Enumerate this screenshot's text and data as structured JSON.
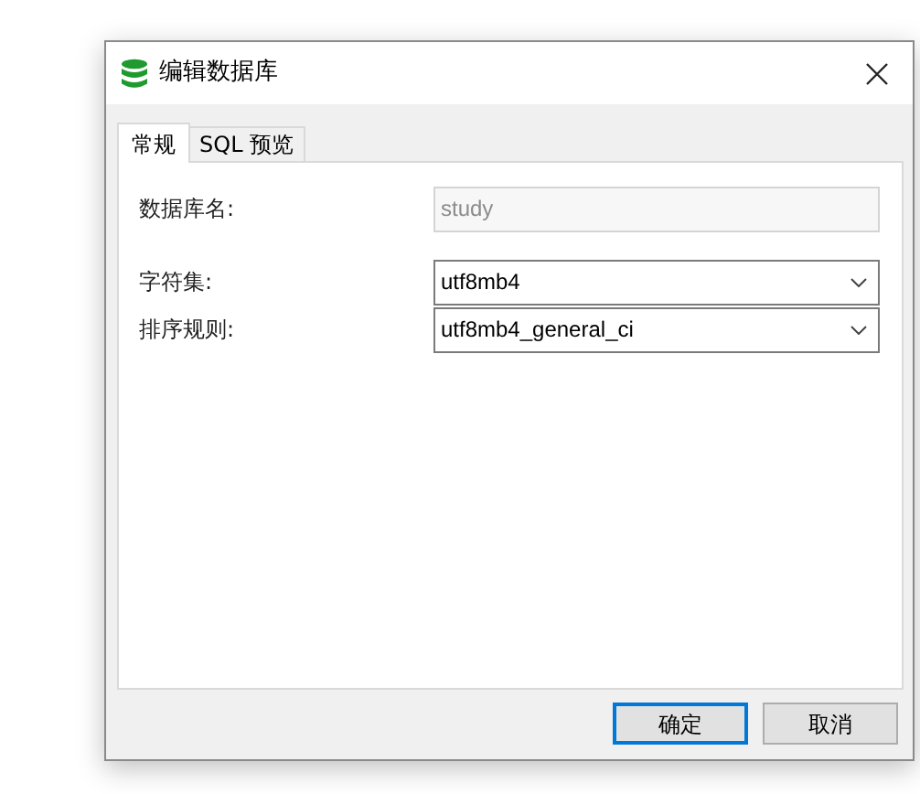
{
  "window": {
    "title": "编辑数据库"
  },
  "tabs": [
    {
      "label": "常规",
      "selected": true
    },
    {
      "label": "SQL 预览",
      "selected": false
    }
  ],
  "fields": [
    {
      "kind": "text",
      "label": "数据库名:",
      "value": "study",
      "disabled": true
    },
    {
      "kind": "select",
      "label": "字符集:",
      "value": "utf8mb4",
      "disabled": false
    },
    {
      "kind": "select",
      "label": "排序规则:",
      "value": "utf8mb4_general_ci",
      "disabled": false
    }
  ],
  "buttons": [
    {
      "label": "确定",
      "default": true
    },
    {
      "label": "取消",
      "default": false
    }
  ]
}
